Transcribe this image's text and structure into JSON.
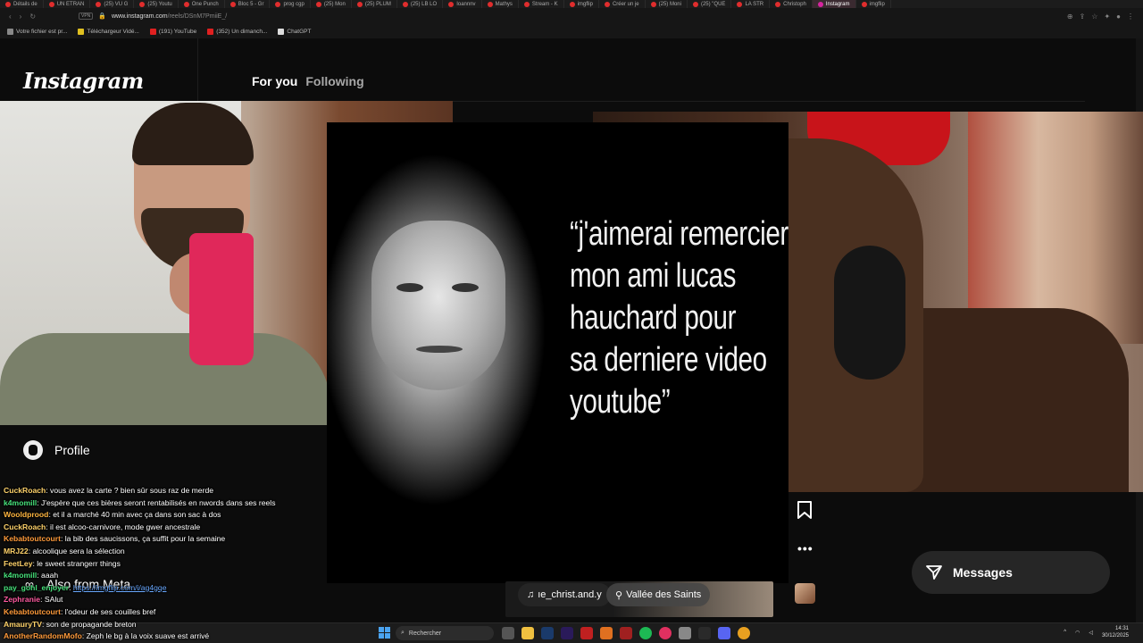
{
  "browser": {
    "tabs": [
      "Détails de",
      "UN ETRAN",
      "(25) VU G",
      "(25) Youtu",
      "One Punch",
      "Bloc 5 - Gr",
      "prog cgp",
      "(25) Mon",
      "(25) PLUM",
      "(25) LB LO",
      "Ioannnv",
      "Mathys",
      "Stream - K",
      "imgflip",
      "Créer un je",
      "(25) Moni",
      "(25) \"QUE",
      "LA STR",
      "Christoph",
      "Instagram",
      "imgflip"
    ],
    "active_tab": "Instagram",
    "url_prefix": "www.instagram.com",
    "url_path": "/reels/DSnM7PmiiE_/",
    "vpn_label": "VPN",
    "bookmarks": [
      "Votre fichier est pr...",
      "Téléchargeur Vidé...",
      "(191) YouTube",
      "(352) Un dimanch...",
      "ChatGPT"
    ]
  },
  "instagram": {
    "logo": "Instagram",
    "feed_tabs": {
      "for_you": "For you",
      "following": "Following"
    },
    "reel_quote": "“j'aimerai remercier\nmon ami lucas\nhauchard pour\nsa derniere video\nyoutube”",
    "audio_chip": "ıe_christ.and.y",
    "location_chip": "Vallée des Saints",
    "profile_label": "Profile",
    "also_from_meta": "Also from Meta",
    "messages_label": "Messages"
  },
  "chat": [
    {
      "user": "CuckRoach",
      "color": "#ffd36b",
      "msg": ": vous avez la carte ? bien sûr sous raz de merde"
    },
    {
      "user": "k4momill",
      "color": "#46e07a",
      "msg": ": J'espère que ces bières seront rentabilisés en nwords dans ses reels"
    },
    {
      "user": "Wooldprood",
      "color": "#ffb640",
      "msg": ": et il a marché 40 min avec ça dans son sac à dos"
    },
    {
      "user": "CuckRoach",
      "color": "#ffd36b",
      "msg": ": il est alcoo-carnivore, mode gwer ancestrale"
    },
    {
      "user": "Kebabtoutcourt",
      "color": "#ff9a3a",
      "msg": ": la bib des saucissons, ça suffit pour la semaine"
    },
    {
      "user": "MRJ22",
      "color": "#ffd36b",
      "msg": ": alcoolique sera la sélection"
    },
    {
      "user": "FeetLey",
      "color": "#ffd36b",
      "msg": ": le sweet strangerr things"
    },
    {
      "user": "k4momill",
      "color": "#46e07a",
      "msg": ": aaah"
    },
    {
      "user": "pay_gohl_enjoyer",
      "color": "#46e07a",
      "msg": ": ",
      "link": "https://imgflip.com/i/ag4gqe"
    },
    {
      "user": "Zephranie",
      "color": "#ff5aa0",
      "msg": ": SAlut"
    },
    {
      "user": "Kebabtoutcourt",
      "color": "#ff9a3a",
      "msg": ": l'odeur de ses couilles bref"
    },
    {
      "user": "AmauryTV",
      "color": "#ffd36b",
      "msg": ": son de propagande breton"
    },
    {
      "user": "AnotherRandomMofo",
      "color": "#ff9a3a",
      "msg": ": Zeph le bg à la voix suave est arrivé"
    }
  ],
  "taskbar": {
    "search_placeholder": "Rechercher",
    "time": "14:31",
    "date": "30/12/2025"
  },
  "colors": {
    "ig_bg": "#0c0c0c",
    "link": "#6aa9ff",
    "cup": "#e0285a"
  },
  "icons": [
    "back-icon",
    "forward-icon",
    "reload-icon",
    "lock-icon",
    "bookmark-icon",
    "more-icon",
    "music-note-icon",
    "location-pin-icon",
    "messages-icon",
    "windows-start-icon",
    "search-icon"
  ]
}
